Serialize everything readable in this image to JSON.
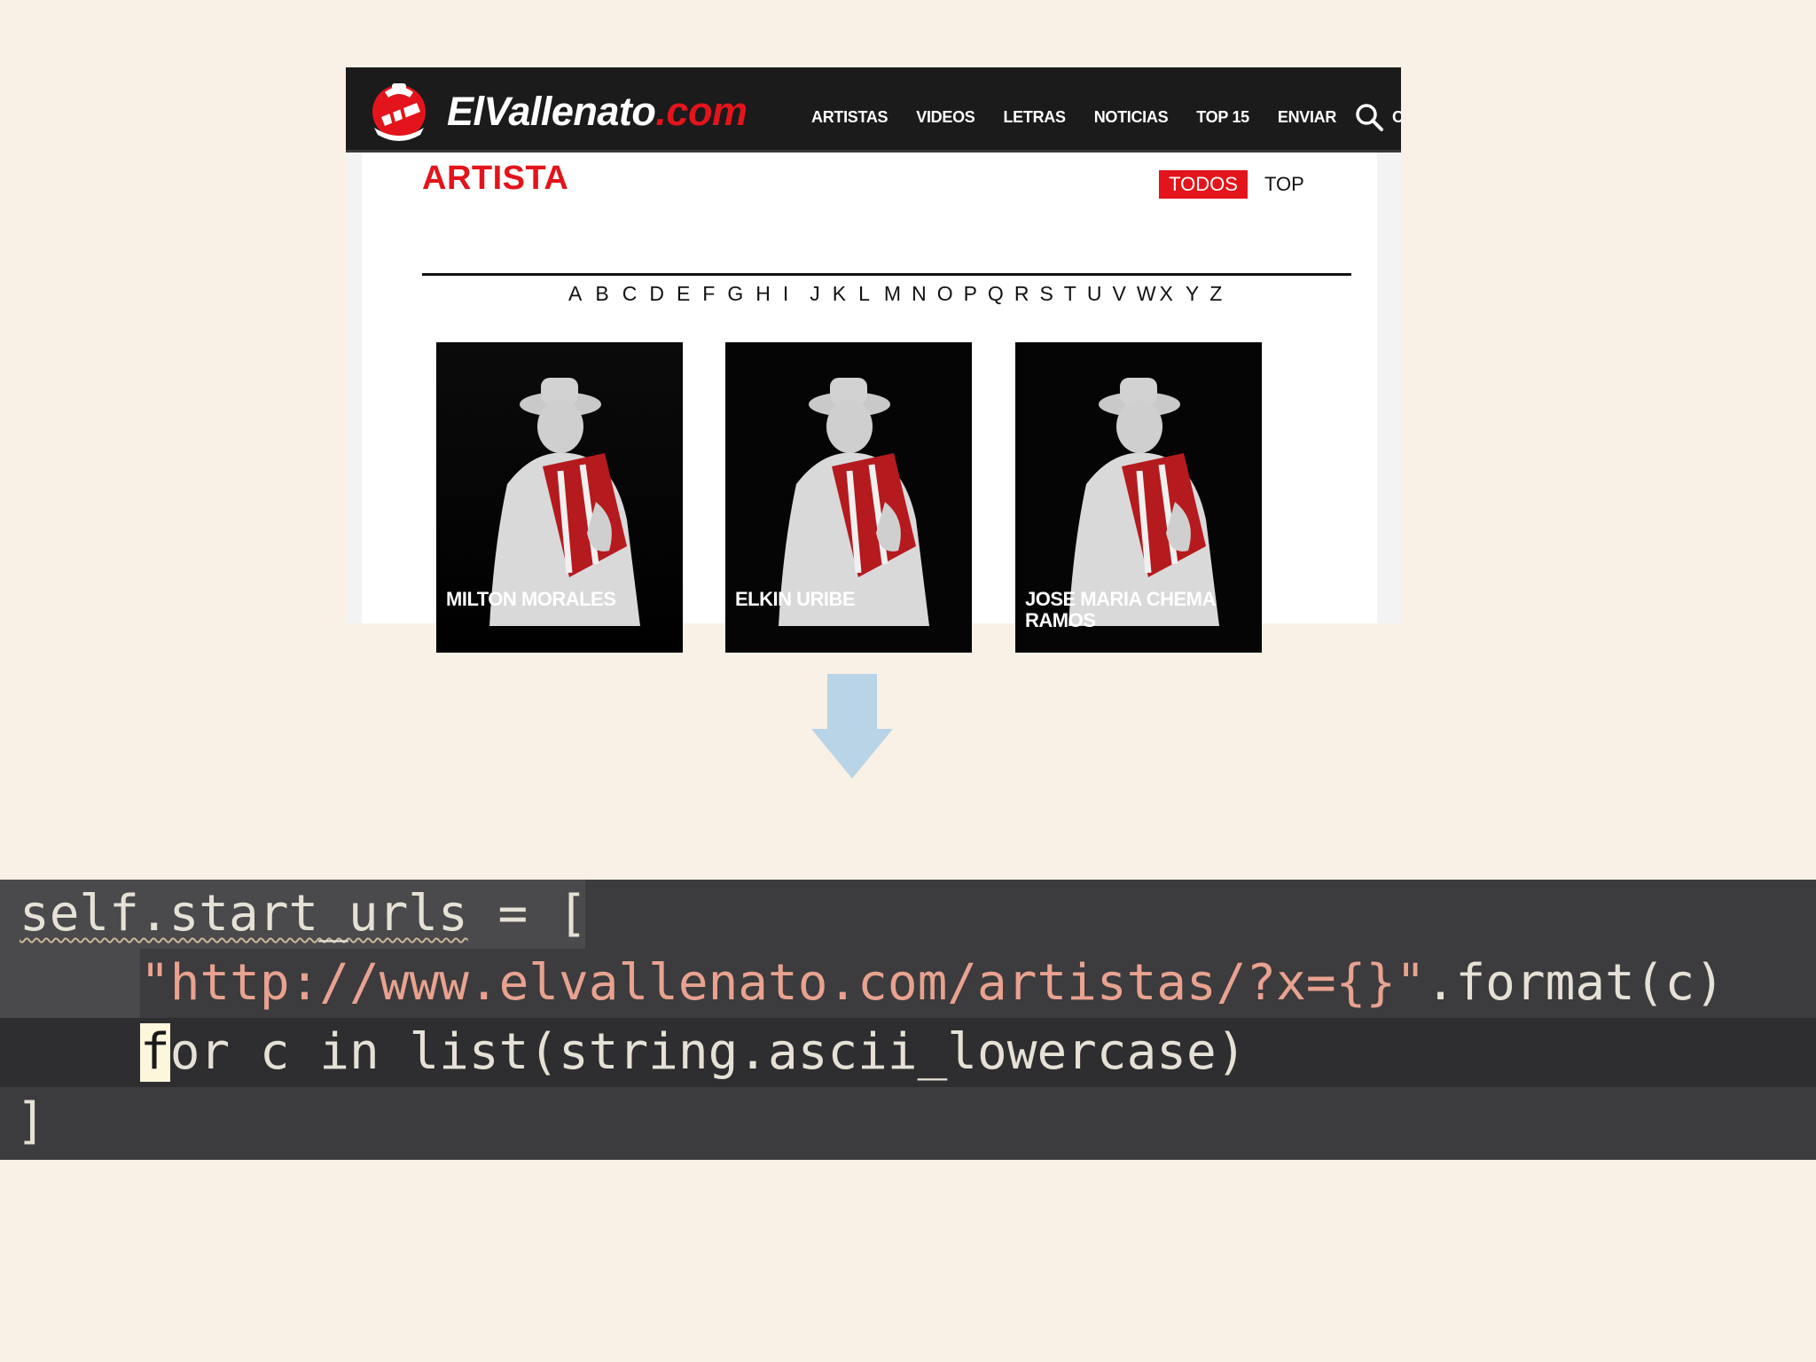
{
  "site": {
    "logo": {
      "name": "ElVallenato",
      "suffix": ".com"
    },
    "nav": [
      "ARTISTAS",
      "VIDEOS",
      "LETRAS",
      "NOTICIAS",
      "TOP 15",
      "ENVIAR"
    ],
    "nav_overflow": "C",
    "section_title": "ARTISTA",
    "tabs": {
      "active": "TODOS",
      "other": "TOP"
    },
    "alphabet": [
      "A",
      "B",
      "C",
      "D",
      "E",
      "F",
      "G",
      "H",
      "I",
      "J",
      "K",
      "L",
      "M",
      "N",
      "O",
      "P",
      "Q",
      "R",
      "S",
      "T",
      "U",
      "V",
      "W",
      "X",
      "Y",
      "Z"
    ],
    "artists": [
      {
        "name": "MILTON MORALES"
      },
      {
        "name": "ELKIN URIBE"
      },
      {
        "name": "JOSE MARIA CHEMA RAMOS"
      }
    ],
    "colors": {
      "brand_red": "#e3141b",
      "header_bg": "#1b1b1b"
    }
  },
  "arrow": {
    "color": "#b8d4e6",
    "icon": "down-arrow-icon"
  },
  "code": {
    "line1": {
      "a": "self.start_urls",
      "b": " = ["
    },
    "line2": {
      "indent": "    ",
      "quote_open": "\"",
      "url": "http://www.elvallenato.com/artistas/?x={}",
      "quote_close": "\"",
      "rest": ".format(c)"
    },
    "line3": {
      "indent": "    ",
      "cursor_char": "f",
      "rest": "or c in list(string.ascii_lowercase)"
    },
    "line4": {
      "text": "]"
    }
  }
}
